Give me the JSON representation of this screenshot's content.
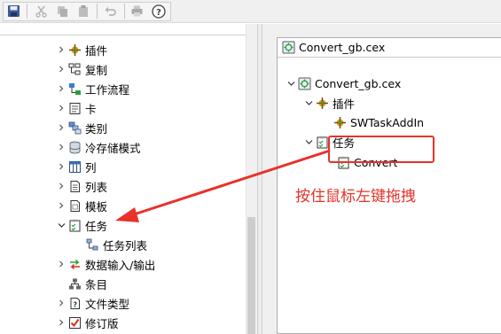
{
  "toolbar": {
    "icons": [
      "save-icon",
      "cut-icon",
      "copy-icon",
      "paste-icon",
      "undo-icon",
      "print-icon",
      "help-icon"
    ]
  },
  "left_tree": {
    "items": [
      {
        "label": "插件",
        "icon": "plugin-icon"
      },
      {
        "label": "复制",
        "icon": "copy-structure-icon"
      },
      {
        "label": "工作流程",
        "icon": "workflow-icon"
      },
      {
        "label": "卡",
        "icon": "card-icon"
      },
      {
        "label": "类别",
        "icon": "category-icon"
      },
      {
        "label": "冷存储模式",
        "icon": "cold-storage-icon"
      },
      {
        "label": "列",
        "icon": "column-icon"
      },
      {
        "label": "列表",
        "icon": "list-icon"
      },
      {
        "label": "模板",
        "icon": "template-icon"
      },
      {
        "label": "任务",
        "icon": "task-icon"
      },
      {
        "label": "任务列表",
        "icon": "task-list-icon"
      },
      {
        "label": "数据输入/输出",
        "icon": "data-io-icon"
      },
      {
        "label": "条目",
        "icon": "item-icon"
      },
      {
        "label": "文件类型",
        "icon": "file-type-icon"
      },
      {
        "label": "修订版",
        "icon": "revision-icon"
      }
    ]
  },
  "right_panel": {
    "title": "Convert_gb.cex",
    "tree": [
      {
        "label": "Convert_gb.cex"
      },
      {
        "label": "插件"
      },
      {
        "label": "SWTaskAddIn"
      },
      {
        "label": "任务"
      },
      {
        "label": "Convert"
      }
    ]
  },
  "annotation": {
    "text": "按住鼠标左键拖拽",
    "color": "#e8322a"
  }
}
